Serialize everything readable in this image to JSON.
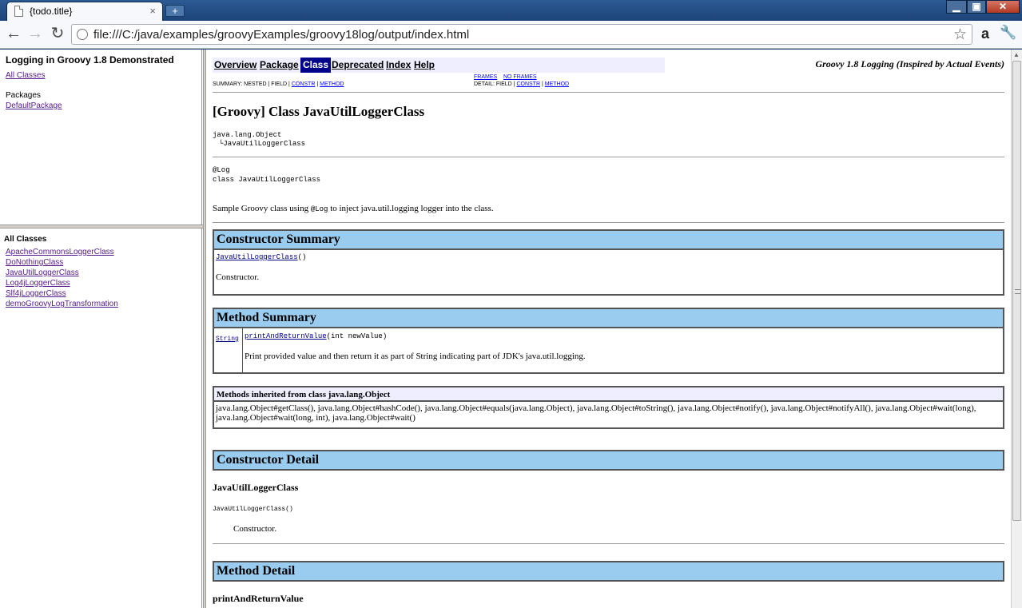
{
  "browser": {
    "tab_title": "{todo.title}",
    "tab_close": "×",
    "new_tab": "+",
    "minimize": "▁",
    "maximize": "▣",
    "close": "✕",
    "back": "←",
    "forward": "→",
    "reload": "↻",
    "url": "file:///C:/java/examples/groovyExamples/groovy18log/output/index.html",
    "star": "☆",
    "amazon": "a",
    "wrench": "🔧"
  },
  "left_top": {
    "title": "Logging in Groovy 1.8 Demonstrated",
    "all_classes_link": "All Classes",
    "packages_heading": "Packages",
    "packages": [
      "DefaultPackage"
    ]
  },
  "left_bottom": {
    "heading": "All Classes",
    "classes": [
      "ApacheCommonsLoggerClass",
      "DoNothingClass",
      "JavaUtilLoggerClass",
      "Log4jLoggerClass",
      "Slf4jLoggerClass",
      "demoGroovyLogTransformation"
    ]
  },
  "main": {
    "nav": {
      "overview": "Overview",
      "package": "Package",
      "class": "Class",
      "deprecated": "Deprecated",
      "index": "Index",
      "help": "Help"
    },
    "doc_header": "Groovy 1.8 Logging (Inspired by Actual Events)",
    "summary_label": "SUMMARY: NESTED | FIELD |",
    "summary_constr": "CONSTR",
    "summary_sep": "|",
    "summary_method": "METHOD",
    "frames": "FRAMES",
    "no_frames": "NO FRAMES",
    "detail_label": "DETAIL: FIELD |",
    "detail_constr": "CONSTR",
    "detail_sep": "|",
    "detail_method": "METHOD",
    "class_title": "[Groovy] Class JavaUtilLoggerClass",
    "hierarchy_root": "java.lang.Object",
    "hierarchy_child": "JavaUtilLoggerClass",
    "annotation": "@Log",
    "declaration": "class JavaUtilLoggerClass",
    "description_before": "Sample Groovy class using ",
    "description_code": "@Log",
    "description_after": " to inject java.util.logging logger into the class.",
    "constructor_summary_title": "Constructor Summary",
    "constructor_summary_link": "JavaUtilLoggerClass",
    "constructor_summary_params": "()",
    "constructor_summary_desc": "Constructor.",
    "method_summary_title": "Method Summary",
    "method_return_type": "String",
    "method_link": "printAndReturnValue",
    "method_params": "(int newValue)",
    "method_desc": "Print provided value and then return it as part of String indicating part of JDK's java.util.logging.",
    "inherited_title": "Methods inherited from class java.lang.Object",
    "inherited_line1": "java.lang.Object#getClass(), java.lang.Object#hashCode(), java.lang.Object#equals(java.lang.Object), java.lang.Object#toString(), java.lang.Object#notify(), java.lang.Object#notifyAll(), java.lang.Object#wait(long),",
    "inherited_line2": "java.lang.Object#wait(long, int), java.lang.Object#wait()",
    "constructor_detail_title": "Constructor Detail",
    "constructor_detail_name": "JavaUtilLoggerClass",
    "constructor_detail_sig": "JavaUtilLoggerClass()",
    "constructor_detail_desc": "Constructor.",
    "method_detail_title": "Method Detail",
    "method_detail_name": "printAndReturnValue"
  }
}
